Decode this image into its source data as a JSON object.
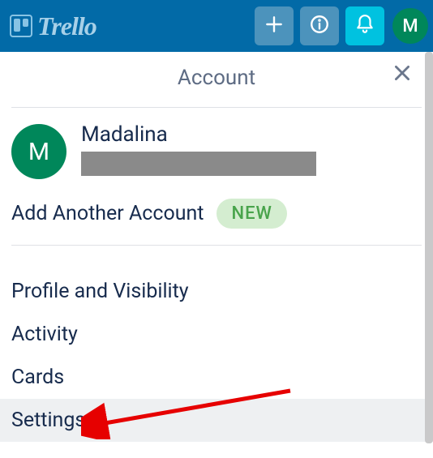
{
  "header": {
    "logo_text": "Trello",
    "avatar_initial": "M"
  },
  "panel": {
    "title": "Account",
    "account": {
      "avatar_initial": "M",
      "name": "Madalina"
    },
    "add_account_label": "Add Another Account",
    "new_badge": "NEW",
    "menu": [
      {
        "label": "Profile and Visibility"
      },
      {
        "label": "Activity"
      },
      {
        "label": "Cards"
      },
      {
        "label": "Settings"
      }
    ]
  }
}
